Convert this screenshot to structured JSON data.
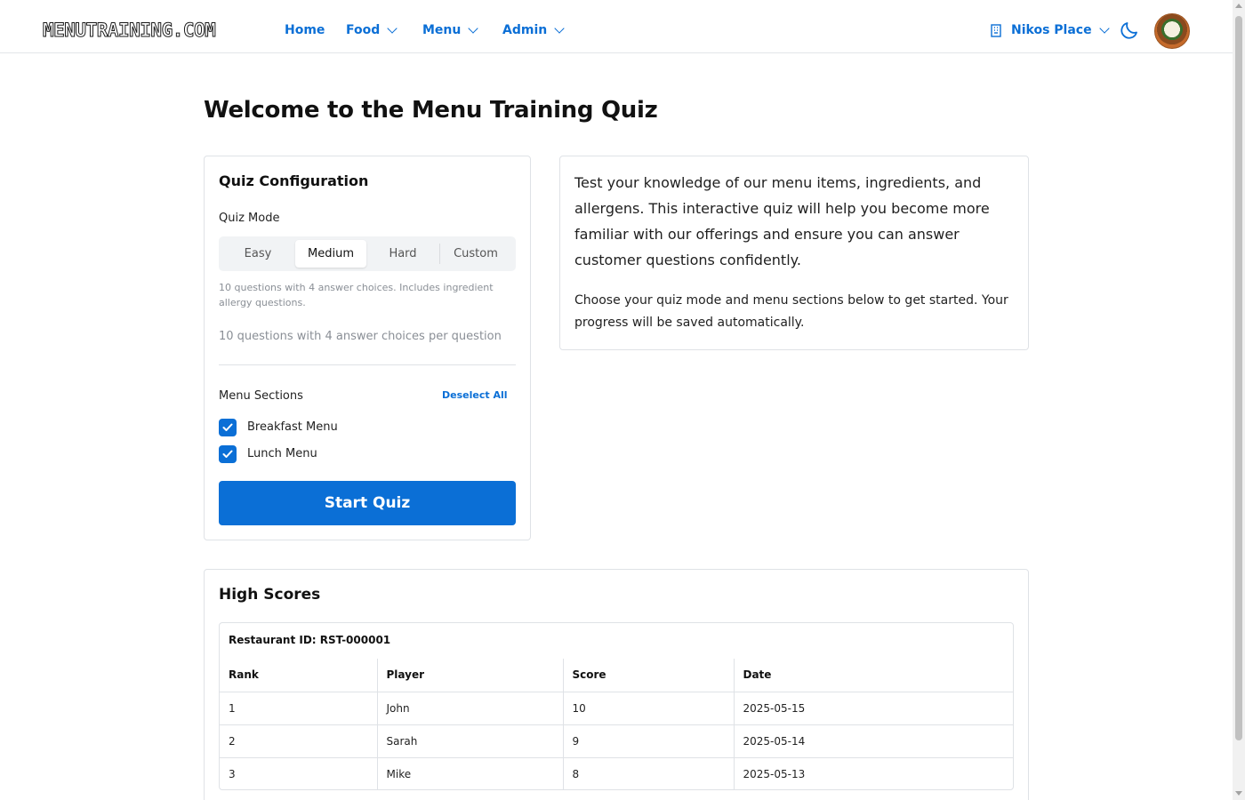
{
  "nav": {
    "logo": "MENUTRAINING.COM",
    "links": [
      {
        "label": "Home"
      },
      {
        "label": "Food"
      },
      {
        "label": "Menu"
      },
      {
        "label": "Admin"
      }
    ],
    "restaurant": "Nikos Place",
    "icons": [
      "building-icon",
      "moon-icon",
      "avatar"
    ]
  },
  "page": {
    "title": "Welcome to the Menu Training Quiz"
  },
  "config": {
    "title": "Quiz Configuration",
    "mode_label": "Quiz Mode",
    "modes": [
      "Easy",
      "Medium",
      "Hard",
      "Custom"
    ],
    "selected_mode": "Medium",
    "mode_description": "10 questions with 4 answer choices. Includes ingredient allergy questions.",
    "mode_summary": "10 questions with 4 answer choices per question",
    "sections_label": "Menu Sections",
    "deselect_all": "Deselect All",
    "sections": [
      {
        "label": "Breakfast Menu",
        "checked": true
      },
      {
        "label": "Lunch Menu",
        "checked": true
      }
    ],
    "start_button": "Start Quiz"
  },
  "info": {
    "paragraph1": "Test your knowledge of our menu items, ingredients, and allergens. This interactive quiz will help you become more familiar with our offerings and ensure you can answer customer questions confidently.",
    "paragraph2": "Choose your quiz mode and menu sections below to get started. Your progress will be saved automatically."
  },
  "scores": {
    "title": "High Scores",
    "restaurant_id": "Restaurant ID: RST-000001",
    "columns": [
      "Rank",
      "Player",
      "Score",
      "Date"
    ],
    "rows": [
      [
        "1",
        "John",
        "10",
        "2025-05-15"
      ],
      [
        "2",
        "Sarah",
        "9",
        "2025-05-14"
      ],
      [
        "3",
        "Mike",
        "8",
        "2025-05-13"
      ]
    ]
  },
  "colors": {
    "accent": "#0b6fd6",
    "border": "#dfe2e6",
    "muted_text": "#8a8f96"
  }
}
